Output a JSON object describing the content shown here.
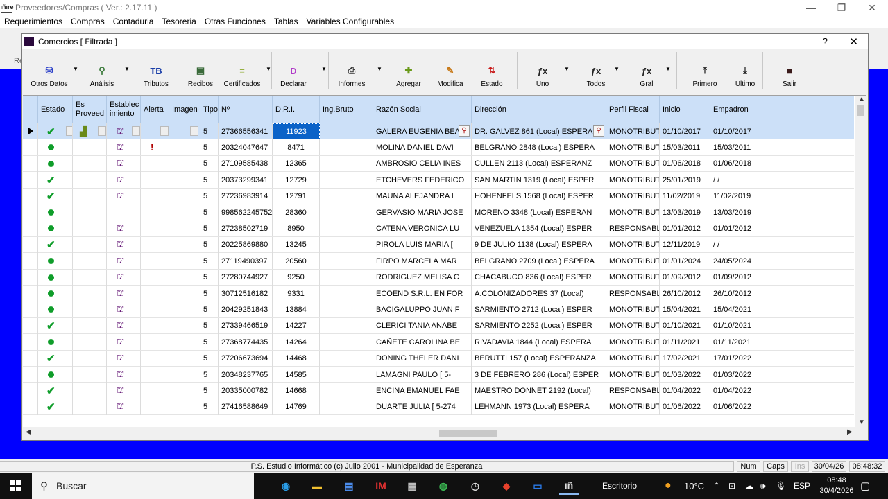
{
  "app": {
    "logo_text": "ıñıre",
    "title": "Proveedores/Compras ( Ver.: 2.17.11 )",
    "menu": [
      "Requerimientos",
      "Compras",
      "Contaduria",
      "Tesoreria",
      "Otras Funciones",
      "Tablas",
      "Variables Configurables"
    ],
    "side_label": "Re"
  },
  "window": {
    "title": "Comercios [ Filtrada ]",
    "help": "?",
    "close": "✕"
  },
  "toolbar": [
    {
      "label": "Otros Datos",
      "icon": "cylinder-icon",
      "glyph": "⛁",
      "color": "#2a3fc8",
      "arrow": true
    },
    {
      "label": "Análisis",
      "icon": "analysis-icon",
      "glyph": "⚲",
      "color": "#3a7a3a",
      "arrow": true
    },
    {
      "label": "Tributos",
      "icon": "tributos-icon",
      "glyph": "TB",
      "color": "#1b3fa8",
      "arrow": false
    },
    {
      "label": "Recibos",
      "icon": "recibos-icon",
      "glyph": "▣",
      "color": "#3a6a3a",
      "arrow": false
    },
    {
      "label": "Certificados",
      "icon": "certificados-icon",
      "glyph": "≡",
      "color": "#8aa82a",
      "arrow": true
    },
    {
      "label": "Declarar",
      "icon": "declarar-icon",
      "glyph": "D",
      "color": "#b03ac8",
      "arrow": true
    },
    {
      "label": "Informes",
      "icon": "printer-icon",
      "glyph": "⎙",
      "color": "#333",
      "arrow": true
    },
    {
      "label": "Agregar",
      "icon": "add-icon",
      "glyph": "✚",
      "color": "#6a9a1a",
      "arrow": false
    },
    {
      "label": "Modifica",
      "icon": "edit-icon",
      "glyph": "✎",
      "color": "#c87a1a",
      "arrow": false
    },
    {
      "label": "Estado",
      "icon": "status-arrows-icon",
      "glyph": "⇅",
      "color": "#c81a1a",
      "arrow": false
    },
    {
      "label": "Uno",
      "icon": "fx-icon",
      "glyph": "ƒx",
      "color": "#222",
      "arrow": true
    },
    {
      "label": "Todos",
      "icon": "fx-icon",
      "glyph": "ƒx",
      "color": "#222",
      "arrow": true
    },
    {
      "label": "Gral",
      "icon": "fx-icon",
      "glyph": "ƒx",
      "color": "#222",
      "arrow": true
    },
    {
      "label": "Primero",
      "icon": "first-icon",
      "glyph": "⤒",
      "color": "#222",
      "arrow": false
    },
    {
      "label": "Ultimo",
      "icon": "last-icon",
      "glyph": "⤓",
      "color": "#222",
      "arrow": false
    },
    {
      "label": "Salir",
      "icon": "exit-icon",
      "glyph": "■",
      "color": "#3a1a1a",
      "arrow": false
    }
  ],
  "columns": [
    "",
    "Estado",
    "Es Proveed",
    "Establec imiento",
    "Alerta",
    "Imagen",
    "Tipo",
    "Nº",
    "D.R.I.",
    "Ing.Bruto",
    "Razón Social",
    "Dirección",
    "Perfil Fiscal",
    "Inicio",
    "Empadron"
  ],
  "rows": [
    {
      "estado": "check",
      "estab": true,
      "alerta": false,
      "tipo": "5",
      "nro": "27366556341",
      "dri": "11923",
      "razon": "GALERA EUGENIA BEA",
      "direccion": "DR. GALVEZ   861 (Local) ESPERA",
      "perfil": "MONOTRIBUT",
      "inicio": "01/10/2017",
      "empadron": "01/10/2017"
    },
    {
      "estado": "dot",
      "estab": true,
      "alerta": true,
      "tipo": "5",
      "nro": "20324047647",
      "dri": "8471",
      "razon": "MOLINA DANIEL DAVI",
      "direccion": "BELGRANO   2848 (Local) ESPERA",
      "perfil": "MONOTRIBUT",
      "inicio": "15/03/2011",
      "empadron": "15/03/2011"
    },
    {
      "estado": "dot",
      "estab": true,
      "alerta": false,
      "tipo": "5",
      "nro": "27109585438",
      "dri": "12365",
      "razon": "AMBROSIO CELIA INES",
      "direccion": "CULLEN   2113 (Local) ESPERANZ",
      "perfil": "MONOTRIBUT",
      "inicio": "01/06/2018",
      "empadron": "01/06/2018"
    },
    {
      "estado": "check",
      "estab": true,
      "alerta": false,
      "tipo": "5",
      "nro": "20373299341",
      "dri": "12729",
      "razon": "ETCHEVERS FEDERICO",
      "direccion": "SAN MARTIN   1319 (Local) ESPER",
      "perfil": "MONOTRIBUT",
      "inicio": "25/01/2019",
      "empadron": "/ /"
    },
    {
      "estado": "check",
      "estab": true,
      "alerta": false,
      "tipo": "5",
      "nro": "27236983914",
      "dri": "12791",
      "razon": "MAUNA ALEJANDRA L",
      "direccion": "HOHENFELS   1568 (Local) ESPER",
      "perfil": "MONOTRIBUT",
      "inicio": "11/02/2019",
      "empadron": "11/02/2019"
    },
    {
      "estado": "dot",
      "estab": false,
      "alerta": false,
      "tipo": "5",
      "nro": "998562245752",
      "dri": "28360",
      "razon": "GERVASIO MARIA JOSE",
      "direccion": "MORENO   3348 (Local) ESPERAN",
      "perfil": "MONOTRIBUT",
      "inicio": "13/03/2019",
      "empadron": "13/03/2019"
    },
    {
      "estado": "dot",
      "estab": true,
      "alerta": false,
      "tipo": "5",
      "nro": "27238502719",
      "dri": "8950",
      "razon": "CATENA VERONICA LU",
      "direccion": "VENEZUELA   1354 (Local) ESPER",
      "perfil": "RESPONSABLE",
      "inicio": "01/01/2012",
      "empadron": "01/01/2012"
    },
    {
      "estado": "check",
      "estab": true,
      "alerta": false,
      "tipo": "5",
      "nro": "20225869880",
      "dri": "13245",
      "razon": "PIROLA LUIS MARIA  [",
      "direccion": "9 DE JULIO   1138 (Local) ESPERA",
      "perfil": "MONOTRIBUT",
      "inicio": "12/11/2019",
      "empadron": "/ /"
    },
    {
      "estado": "dot",
      "estab": true,
      "alerta": false,
      "tipo": "5",
      "nro": "27119490397",
      "dri": "20560",
      "razon": "FIRPO MARCELA MAR",
      "direccion": "BELGRANO   2709 (Local) ESPERA",
      "perfil": "MONOTRIBUT",
      "inicio": "01/01/2024",
      "empadron": "24/05/2024"
    },
    {
      "estado": "dot",
      "estab": true,
      "alerta": false,
      "tipo": "5",
      "nro": "27280744927",
      "dri": "9250",
      "razon": "RODRIGUEZ MELISA C",
      "direccion": "CHACABUCO   836 (Local) ESPER",
      "perfil": "MONOTRIBUT",
      "inicio": "01/09/2012",
      "empadron": "01/09/2012"
    },
    {
      "estado": "dot",
      "estab": true,
      "alerta": false,
      "tipo": "5",
      "nro": "30712516182",
      "dri": "9331",
      "razon": "ECOEND S.R.L. EN FOR",
      "direccion": "A.COLONIZADORES   37 (Local)",
      "perfil": "RESPONSABLE",
      "inicio": "26/10/2012",
      "empadron": "26/10/2012"
    },
    {
      "estado": "dot",
      "estab": true,
      "alerta": false,
      "tipo": "5",
      "nro": "20429251843",
      "dri": "13884",
      "razon": "BACIGALUPPO JUAN F",
      "direccion": "SARMIENTO   2712 (Local) ESPER",
      "perfil": "MONOTRIBUT",
      "inicio": "15/04/2021",
      "empadron": "15/04/2021"
    },
    {
      "estado": "check",
      "estab": true,
      "alerta": false,
      "tipo": "5",
      "nro": "27339466519",
      "dri": "14227",
      "razon": "CLERICI TANIA ANABE",
      "direccion": "SARMIENTO   2252 (Local) ESPER",
      "perfil": "MONOTRIBUT",
      "inicio": "01/10/2021",
      "empadron": "01/10/2021"
    },
    {
      "estado": "dot",
      "estab": true,
      "alerta": false,
      "tipo": "5",
      "nro": "27368774435",
      "dri": "14264",
      "razon": "CAÑETE CAROLINA BE",
      "direccion": "RIVADAVIA   1844 (Local) ESPERA",
      "perfil": "MONOTRIBUT",
      "inicio": "01/11/2021",
      "empadron": "01/11/2021"
    },
    {
      "estado": "check",
      "estab": true,
      "alerta": false,
      "tipo": "5",
      "nro": "27206673694",
      "dri": "14468",
      "razon": "DONING THELER DANI",
      "direccion": "BERUTTI   157 (Local) ESPERANZA",
      "perfil": "MONOTRIBUT",
      "inicio": "17/02/2021",
      "empadron": "17/01/2022"
    },
    {
      "estado": "dot",
      "estab": true,
      "alerta": false,
      "tipo": "5",
      "nro": "20348237765",
      "dri": "14585",
      "razon": "LAMAGNI PAULO  [ 5-",
      "direccion": "3 DE FEBRERO   286 (Local) ESPER",
      "perfil": "MONOTRIBUT",
      "inicio": "01/03/2022",
      "empadron": "01/03/2022"
    },
    {
      "estado": "check",
      "estab": true,
      "alerta": false,
      "tipo": "5",
      "nro": "20335000782",
      "dri": "14668",
      "razon": "ENCINA EMANUEL FAE",
      "direccion": "MAESTRO DONNET   2192 (Local)",
      "perfil": "RESPONSABLE",
      "inicio": "01/04/2022",
      "empadron": "01/04/2022"
    },
    {
      "estado": "check",
      "estab": true,
      "alerta": false,
      "tipo": "5",
      "nro": "27416588649",
      "dri": "14769",
      "razon": "DUARTE JULIA  [ 5-274",
      "direccion": "LEHMANN   1973 (Local) ESPERA",
      "perfil": "MONOTRIBUT",
      "inicio": "01/06/2022",
      "empadron": "01/06/2022"
    }
  ],
  "statusbar": {
    "text": "P.S. Estudio Informático (c) Julio 2001 - Municipalidad de Esperanza",
    "num": "Num",
    "caps": "Caps",
    "ins": "Ins",
    "date": "30/04/26",
    "time": "08:48:32"
  },
  "taskbar": {
    "search": "Buscar",
    "escritorio": "Escritorio",
    "temp": "10°C",
    "lang": "ESP",
    "clock_time": "08:48",
    "clock_date": "30/4/2026"
  }
}
